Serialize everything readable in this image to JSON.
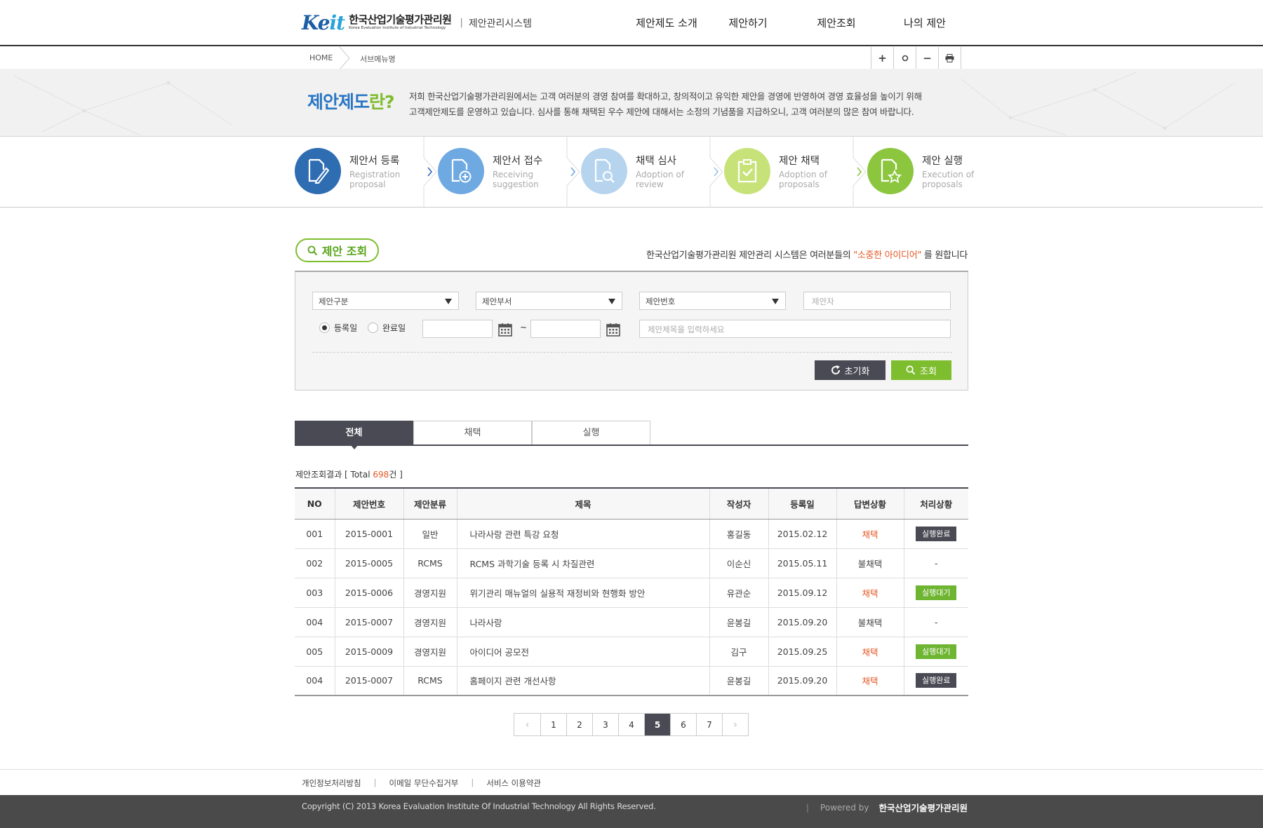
{
  "header": {
    "logo_en_mark": "Keit",
    "logo_kr": "한국산업기술평가관리원",
    "logo_en": "Korea Evaluation Institute of Industrial Technology",
    "system_name": "제안관리시스템",
    "nav": [
      "제안제도 소개",
      "제안하기",
      "제안조회",
      "나의 제안"
    ]
  },
  "location": {
    "home": "HOME",
    "submenu": "서브메뉴명",
    "tools": [
      "+",
      "o",
      "−",
      "print-icon"
    ]
  },
  "intro": {
    "title_part1": "제안제도",
    "title_part2": "란?",
    "line1": "저희 한국산업기술평가관리원에서는 고객 여러분의 경영 참여를 확대하고, 창의적이고 유익한 제안을 경영에 반영하여 경영 효율성을 높이기 위해",
    "line2": "고객제안제도를 운영하고 있습니다. 심사를 통해 채택된 우수 제안에 대해서는 소정의 기념품을 지급하오니, 고객 여러분의 많은 참여 바랍니다."
  },
  "steps": [
    {
      "ko": "제안서 등록",
      "en1": "Registration",
      "en2": "proposal",
      "color": "#2f6db3",
      "icon": "document-edit-icon"
    },
    {
      "ko": "제안서 접수",
      "en1": "Receiving",
      "en2": "suggestion",
      "color": "#6ea9e2",
      "icon": "document-add-icon"
    },
    {
      "ko": "채택 심사",
      "en1": "Adoption of",
      "en2": "review",
      "color": "#b7d4ef",
      "icon": "document-search-icon"
    },
    {
      "ko": "제안 채택",
      "en1": "Adoption of",
      "en2": "proposals",
      "color": "#c8e27a",
      "icon": "clipboard-check-icon"
    },
    {
      "ko": "제안 실행",
      "en1": "Execution of",
      "en2": "proposals",
      "color": "#8cc63e",
      "icon": "document-star-icon"
    }
  ],
  "section": {
    "title": "제안 조회",
    "msg_pre": "한국산업기술평가관리원 제안관리 시스템은 여러분들의 ",
    "msg_hl": "\"소중한 아이디어\"",
    "msg_post": " 를 원합니다"
  },
  "search": {
    "select1": "제안구분",
    "select2": "제안부서",
    "select3": "제안번호",
    "proposer_placeholder": "제안자",
    "radio1": "등록일",
    "radio2": "완료일",
    "tilde": "~",
    "title_placeholder": "제안제목을 입력하세요",
    "reset_label": "초기화",
    "search_label": "조회"
  },
  "tabs": [
    "전체",
    "채택",
    "실행"
  ],
  "result": {
    "label_pre": "제안조회결과 [ Total ",
    "count": "698",
    "label_post": "건 ]"
  },
  "table": {
    "headers": [
      "NO",
      "제안번호",
      "제안분류",
      "제목",
      "작성자",
      "등록일",
      "답변상황",
      "처리상황"
    ],
    "rows": [
      [
        "001",
        "2015-0001",
        "일반",
        "나라사랑 관련 특강 요청",
        "홍길동",
        "2015.02.12",
        "채택",
        "실행완료"
      ],
      [
        "002",
        "2015-0005",
        "RCMS",
        "RCMS 과학기술 등록 시 차질관련",
        "이순신",
        "2015.05.11",
        "불채택",
        "-"
      ],
      [
        "003",
        "2015-0006",
        "경영지원",
        "위기관리 매뉴얼의 실용적 재정비와 현행화 방안",
        "유관순",
        "2015.09.12",
        "채택",
        "실행대기"
      ],
      [
        "004",
        "2015-0007",
        "경영지원",
        "나라사랑",
        "윤봉길",
        "2015.09.20",
        "불채택",
        "-"
      ],
      [
        "005",
        "2015-0009",
        "경영지원",
        "아이디어 공모전",
        "김구",
        "2015.09.25",
        "채택",
        "실행대기"
      ],
      [
        "004",
        "2015-0007",
        "RCMS",
        "홈페이지 관련 개선사항",
        "윤봉길",
        "2015.09.20",
        "채택",
        "실행완료"
      ]
    ]
  },
  "pagination": {
    "prev": "‹",
    "pages": [
      "1",
      "2",
      "3",
      "4",
      "5",
      "6",
      "7"
    ],
    "current": "5",
    "next": "›"
  },
  "footer": {
    "links": [
      "개인정보처리방침",
      "이메일 무단수집거부",
      "서비스 이용약관"
    ],
    "copyright": "Copyright (C) 2013 Korea Evaluation Institute Of Industrial Technology All Rights Reserved.",
    "powered": "Powered by",
    "org": "한국산업기술평가관리원"
  },
  "colors": {
    "accent_green": "#7ebd2e",
    "accent_blue": "#2a76c3",
    "dark": "#4a4a55",
    "highlight": "#e55826"
  }
}
